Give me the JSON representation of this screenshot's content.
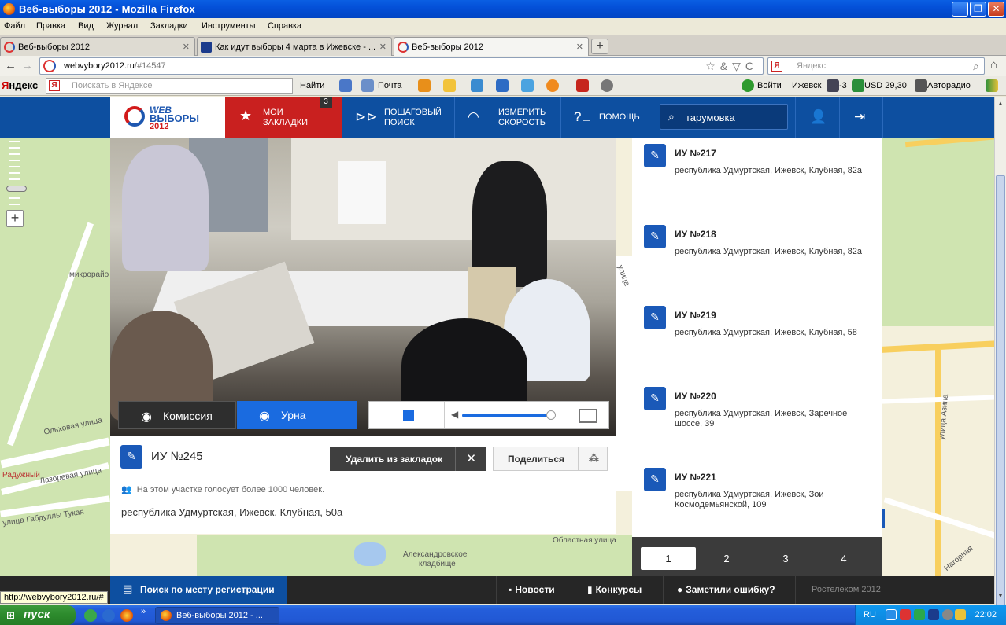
{
  "window": {
    "title": "Веб-выборы 2012 - Mozilla Firefox",
    "minimize": "_",
    "maximize": "❐",
    "close": "✕"
  },
  "menu": [
    "Файл",
    "Правка",
    "Вид",
    "Журнал",
    "Закладки",
    "Инструменты",
    "Справка"
  ],
  "tabs": [
    {
      "label": "Веб-выборы 2012",
      "close": "✕"
    },
    {
      "label": "Как идут выборы 4 марта в Ижевске - ...",
      "close": "✕"
    },
    {
      "label": "Веб-выборы 2012",
      "close": "✕"
    }
  ],
  "newtab": "+",
  "navbar": {
    "back": "←",
    "forward": "→",
    "url_host": "webvybory2012.ru",
    "url_rest": "/#14547",
    "url_tools": "☆&▽C",
    "search_placeholder": "Яндекс",
    "search_icon": "⌕",
    "ya_glyph": "Я"
  },
  "yandex_bar": {
    "brand_red": "Я",
    "brand_black": "ндекс",
    "search_placeholder": "Поискать в Яндексе",
    "find": "Найти",
    "mail": "Почта",
    "login": "Войти",
    "city": "Ижевск",
    "temp": "-3",
    "usd": "USD 29,30",
    "radio": "Авторадио"
  },
  "site_header": {
    "logo_web": "WEB",
    "logo_vybory": "ВЫБОРЫ",
    "logo_year": "2012",
    "bookmarks_label_1": "МОИ",
    "bookmarks_label_2": "ЗАКЛАДКИ",
    "bookmarks_count": "3",
    "step_search_1": "ПОШАГОВЫЙ",
    "step_search_2": "ПОИСК",
    "speed_1": "ИЗМЕРИТЬ",
    "speed_2": "СКОРОСТЬ",
    "help": "ПОМОЩЬ",
    "search_value": "тарумовка"
  },
  "map_labels": {
    "microdistrict": "микрорайо",
    "olkhovaya": "Ольховая улица",
    "raduzhny": "Радужный",
    "lazorevaya": "Лазоревая улица",
    "gabdully": "улица Габдуллы Тукая",
    "oblastnaya": "Областная улица",
    "cemetery_1": "Александровское",
    "cemetery_2": "кладбище",
    "ulitsa": "улица",
    "azina": "улица Азина",
    "nagornaya": "Нагорная"
  },
  "camera": {
    "commission": "Комиссия",
    "urn": "Урна",
    "speaker_glyph": "◀"
  },
  "station": {
    "marker_glyph": "✎",
    "title": "ИУ №245",
    "remove_bookmark": "Удалить из закладок",
    "remove_x": "✕",
    "share": "Поделиться",
    "share_icon": "⁂",
    "people_icon": "👥",
    "voters_note": "На этом участке голосует более 1000 человек.",
    "address": "республика Удмуртская, Ижевск, Клубная, 50а"
  },
  "stations_list": [
    {
      "name": "ИУ №217",
      "address": "республика Удмуртская, Ижевск, Клубная, 82а"
    },
    {
      "name": "ИУ №218",
      "address": "республика Удмуртская, Ижевск, Клубная, 82а"
    },
    {
      "name": "ИУ №219",
      "address": "республика Удмуртская, Ижевск, Клубная, 58"
    },
    {
      "name": "ИУ №220",
      "address": "республика Удмуртская, Ижевск, Заречное шоссе, 39"
    },
    {
      "name": "ИУ №221",
      "address": "республика Удмуртская, Ижевск, Зои Космодемьянской, 109"
    }
  ],
  "pagination": {
    "pages": [
      "1",
      "2",
      "3",
      "4"
    ],
    "active": "1"
  },
  "footer": {
    "reg_search": "Поиск по месту регистрации",
    "news": "Новости",
    "contests": "Конкурсы",
    "feedback": "Заметили ошибку?",
    "copyright": "Ростелеком 2012"
  },
  "status_url": "http://webvybory2012.ru/#",
  "taskbar": {
    "start": "пуск",
    "task_label": "Веб-выборы 2012 - ...",
    "lang": "RU",
    "time": "22:02",
    "quicklaunch_more": "»"
  },
  "colors": {
    "site_blue": "#0d4fa0",
    "bookmarks_red": "#c9201f",
    "marker_blue": "#1a59b8"
  }
}
